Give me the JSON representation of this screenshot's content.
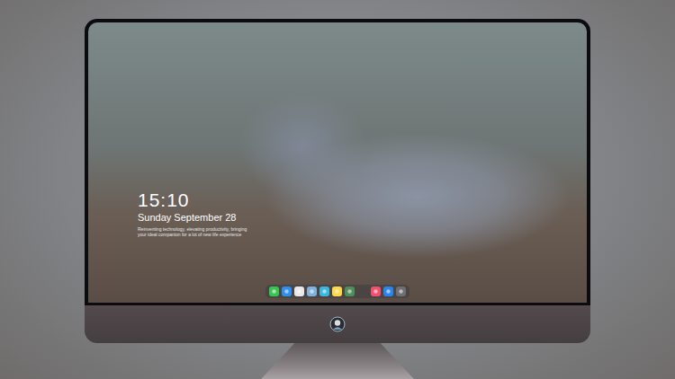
{
  "screen": {
    "clock": {
      "time": "15:10",
      "date": "Sunday September 28",
      "tagline": [
        "Reinventing technology, elevating productivity, bringing",
        "your ideal companion for a lot of new life experience"
      ]
    }
  },
  "dock": {
    "items": [
      {
        "kind": "app",
        "color": "#36c552"
      },
      {
        "kind": "app",
        "color": "#2f8ff0"
      },
      {
        "kind": "app",
        "color": "#e8e8ea"
      },
      {
        "kind": "app",
        "color": "#7fb3dc"
      },
      {
        "kind": "app",
        "color": "#3ab8e0"
      },
      {
        "kind": "app",
        "color": "#ffd84a"
      },
      {
        "kind": "app",
        "color": "#4e8f5c"
      },
      {
        "kind": "separator"
      },
      {
        "kind": "app",
        "color": "#f4506e"
      },
      {
        "kind": "app",
        "color": "#2a86ee"
      },
      {
        "kind": "app",
        "color": "#6e6e74"
      }
    ]
  }
}
